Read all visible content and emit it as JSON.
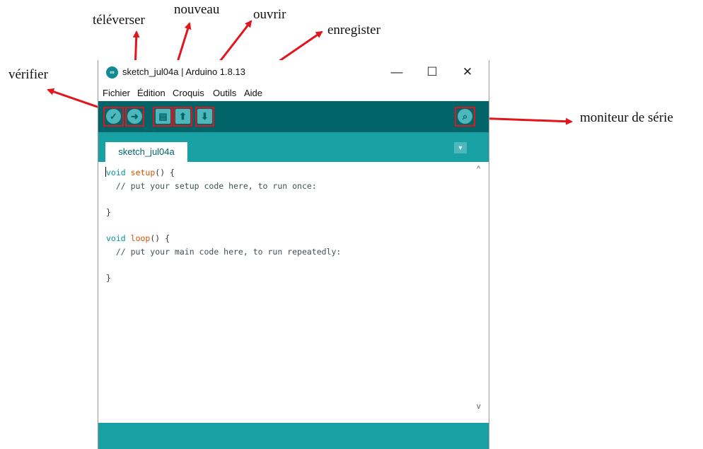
{
  "annotations": {
    "verifier": "vérifier",
    "televerser": "téléverser",
    "nouveau": "nouveau",
    "ouvrir": "ouvrir",
    "enregister": "enregister",
    "moniteur": "moniteur de série"
  },
  "window": {
    "title": "sketch_jul04a | Arduino 1.8.13",
    "logo_text": "∞",
    "minimize": "—",
    "maximize": "☐",
    "close": "✕"
  },
  "menu": [
    "Fichier",
    "Édition",
    "Croquis",
    "Outils",
    "Aide"
  ],
  "toolbar": {
    "verify_icon": "✓",
    "upload_icon": "➜",
    "new_icon": "▤",
    "open_icon": "⬆",
    "save_icon": "⬇",
    "serial_icon": "⌕"
  },
  "tab": {
    "label": "sketch_jul04a",
    "menu_icon": "▼"
  },
  "code": {
    "line1_kw": "void",
    "line1_fn": "setup",
    "line1_rest": "() {",
    "line2": "  // put your setup code here, to run once:",
    "line4": "}",
    "line6_kw": "void",
    "line6_fn": "loop",
    "line6_rest": "() {",
    "line7": "  // put your main code here, to run repeatedly:",
    "line9": "}"
  },
  "scroll": {
    "up": "^",
    "down": "v"
  },
  "colors": {
    "toolbar": "#006468",
    "tabbar": "#17a1a5",
    "button": "#4db7bb",
    "annotation_red": "#e3141b"
  }
}
